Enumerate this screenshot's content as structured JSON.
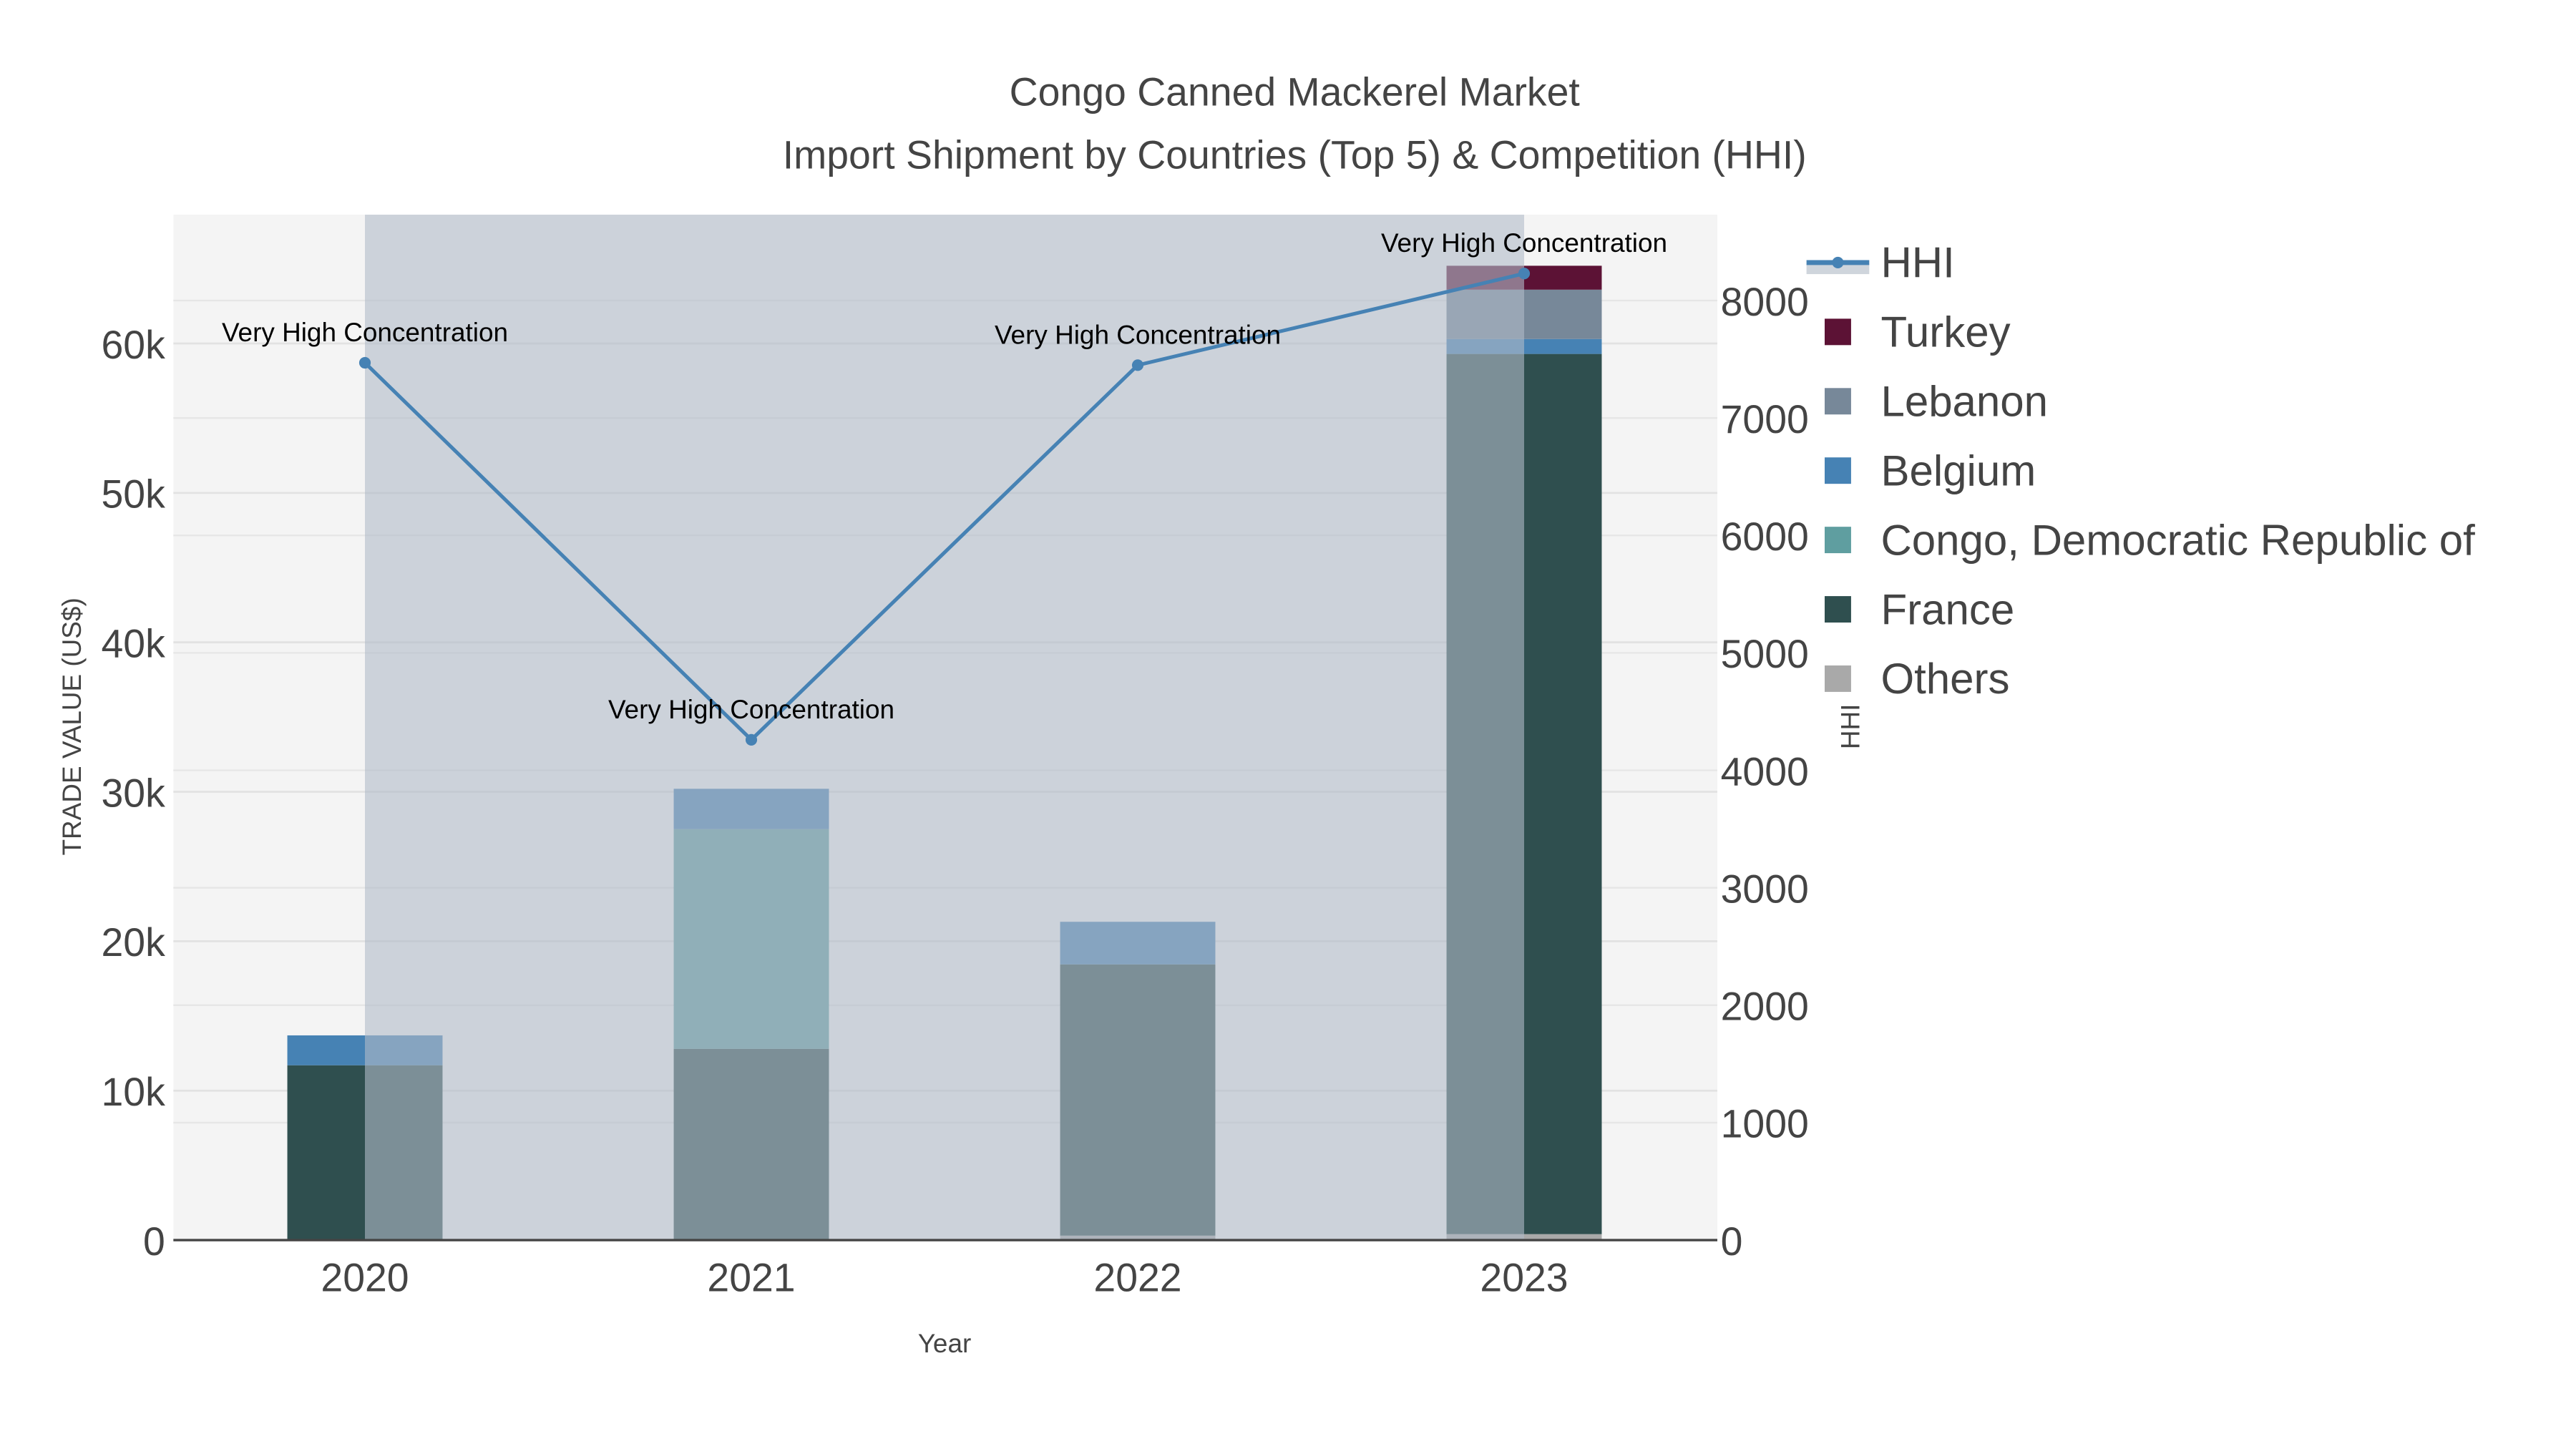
{
  "chart_data": {
    "type": "bar",
    "title": "Congo Canned Mackerel Market",
    "subtitle": "Import Shipment by Countries (Top 5) & Competition (HHI)",
    "xlabel": "Year",
    "ylabel": "TRADE VALUE (US$)",
    "y2label": "HHI",
    "categories": [
      "2020",
      "2021",
      "2022",
      "2023"
    ],
    "ylim": [
      0,
      66000
    ],
    "y2lim": [
      0,
      8500
    ],
    "yticks": [
      0,
      10000,
      20000,
      30000,
      40000,
      50000,
      60000
    ],
    "ytick_labels": [
      "0",
      "10k",
      "20k",
      "30k",
      "40k",
      "50k",
      "60k"
    ],
    "y2ticks": [
      0,
      1000,
      2000,
      3000,
      4000,
      5000,
      6000,
      7000,
      8000
    ],
    "y2tick_labels": [
      "0",
      "1000",
      "2000",
      "3000",
      "4000",
      "5000",
      "6000",
      "7000",
      "8000"
    ],
    "grid": true,
    "legend_position": "right",
    "series": [
      {
        "name": "Others",
        "color": "#a9a9a9",
        "values": [
          0,
          0,
          300,
          400
        ]
      },
      {
        "name": "France",
        "color": "#2f4f4f",
        "values": [
          11700,
          12800,
          18150,
          58900
        ]
      },
      {
        "name": "Congo, Democratic Republic of",
        "color": "#5f9ea0",
        "values": [
          0,
          14700,
          0,
          0
        ]
      },
      {
        "name": "Belgium",
        "color": "#4682b4",
        "values": [
          2000,
          2700,
          2850,
          1000
        ]
      },
      {
        "name": "Lebanon",
        "color": "#778899",
        "values": [
          0,
          0,
          0,
          3300
        ]
      },
      {
        "name": "Turkey",
        "color": "#5c1235",
        "values": [
          0,
          0,
          0,
          1600
        ]
      }
    ],
    "hhi": {
      "name": "HHI",
      "color": "#4682b4",
      "values": [
        7470,
        4260,
        7450,
        8230
      ]
    },
    "annotations": [
      "Very High Concentration",
      "Very High Concentration",
      "Very High Concentration",
      "Very High Concentration"
    ],
    "legend_order": [
      "HHI",
      "Turkey",
      "Lebanon",
      "Belgium",
      "Congo, Democratic Republic of",
      "France",
      "Others"
    ]
  }
}
